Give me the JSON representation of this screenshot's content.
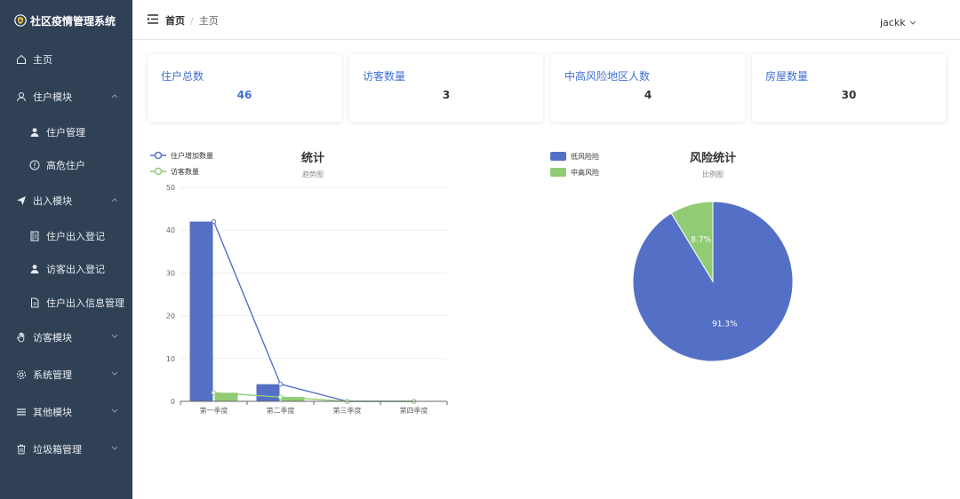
{
  "app": {
    "title": "社区疫情管理系统"
  },
  "sidebar": {
    "items": [
      {
        "label": "主页",
        "icon": "home-icon"
      },
      {
        "label": "住户模块",
        "icon": "user-icon",
        "expanded": true
      },
      {
        "label": "住户管理",
        "icon": "person-icon"
      },
      {
        "label": "高危住户",
        "icon": "warning-circle-icon"
      },
      {
        "label": "出入模块",
        "icon": "send-icon",
        "expanded": true
      },
      {
        "label": "住户出入登记",
        "icon": "notebook-icon"
      },
      {
        "label": "访客出入登记",
        "icon": "person-icon"
      },
      {
        "label": "住户出入信息管理",
        "icon": "document-icon"
      },
      {
        "label": "访客模块",
        "icon": "hand-icon",
        "expanded": false
      },
      {
        "label": "系统管理",
        "icon": "gear-icon",
        "expanded": false
      },
      {
        "label": "其他模块",
        "icon": "list-icon",
        "expanded": false
      },
      {
        "label": "垃圾箱管理",
        "icon": "trash-icon",
        "expanded": false
      }
    ]
  },
  "header": {
    "breadcrumb": {
      "home": "首页",
      "separator": "/",
      "current": "主页"
    },
    "username": "jackk"
  },
  "stats": [
    {
      "title": "住户总数",
      "value": "46"
    },
    {
      "title": "访客数量",
      "value": "3"
    },
    {
      "title": "中高风险地区人数",
      "value": "4"
    },
    {
      "title": "房屋数量",
      "value": "30"
    }
  ],
  "colors": {
    "blue": "#5470c6",
    "green": "#91cc75",
    "sidebar": "#304156",
    "accent": "#3f6fd8"
  },
  "chart_data": [
    {
      "type": "bar",
      "title": "统计",
      "subtitle": "趋势图",
      "categories": [
        "第一季度",
        "第二季度",
        "第三季度",
        "第四季度"
      ],
      "ylim": [
        0,
        50
      ],
      "yticks": [
        0,
        10,
        20,
        30,
        40,
        50
      ],
      "series": [
        {
          "name": "住户增加数量",
          "values": [
            42,
            4,
            0,
            0
          ]
        },
        {
          "name": "访客数量",
          "values": [
            2,
            1,
            0,
            0
          ]
        }
      ],
      "legend_position": "top-left",
      "grid": true
    },
    {
      "type": "pie",
      "title": "风险统计",
      "subtitle": "比例图",
      "slices": [
        {
          "name": "低风险险",
          "value": 91.3,
          "label": "91.3%"
        },
        {
          "name": "中高风险",
          "value": 8.7,
          "label": "8.7%"
        }
      ],
      "legend_position": "top-left"
    }
  ]
}
